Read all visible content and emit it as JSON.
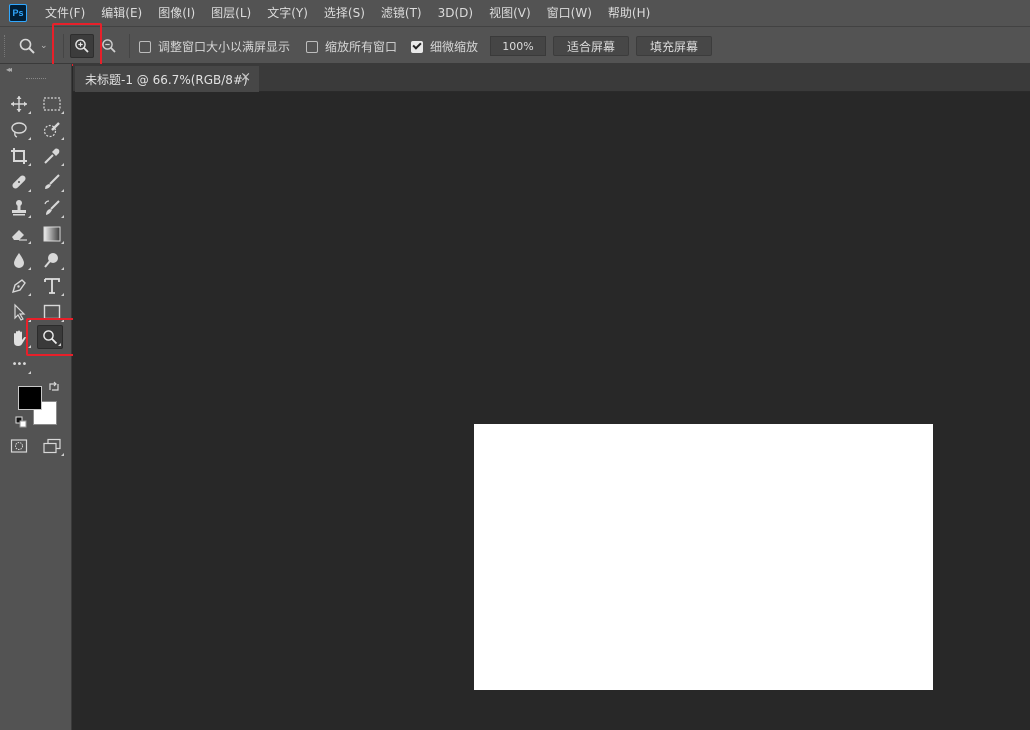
{
  "app": {
    "logo": "Ps"
  },
  "menu": [
    {
      "label": "文件(F)"
    },
    {
      "label": "编辑(E)"
    },
    {
      "label": "图像(I)"
    },
    {
      "label": "图层(L)"
    },
    {
      "label": "文字(Y)"
    },
    {
      "label": "选择(S)"
    },
    {
      "label": "滤镜(T)"
    },
    {
      "label": "3D(D)"
    },
    {
      "label": "视图(V)"
    },
    {
      "label": "窗口(W)"
    },
    {
      "label": "帮助(H)"
    }
  ],
  "options": {
    "tool_icon": "zoom-tool-icon",
    "zoom_in_icon": "zoom-in-icon",
    "zoom_out_icon": "zoom-out-icon",
    "resize_windows_label": "调整窗口大小以满屏显示",
    "resize_windows_checked": false,
    "zoom_all_label": "缩放所有窗口",
    "zoom_all_checked": false,
    "scrubby_zoom_label": "细微缩放",
    "scrubby_zoom_checked": true,
    "zoom_value": "100%",
    "fit_screen_label": "适合屏幕",
    "fill_screen_label": "填充屏幕"
  },
  "document_tab": {
    "title": "未标题-1 @ 66.7%(RGB/8#)",
    "close_glyph": "×"
  },
  "toolbar": {
    "collapse_glyph": "◂◂",
    "more_glyph": "•••",
    "foreground_color": "#000000",
    "background_color": "#ffffff"
  },
  "highlight_color": "#e8202a",
  "canvas_color": "#ffffff"
}
